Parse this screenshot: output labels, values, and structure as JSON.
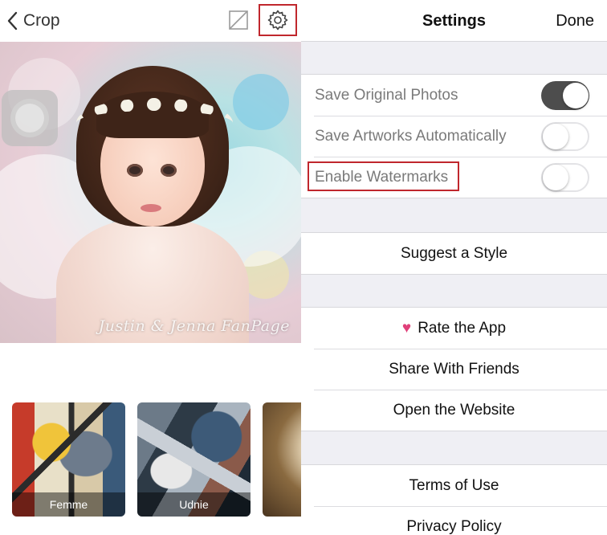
{
  "editor": {
    "back_label": "Crop",
    "watermark": "Justin & Jenna FanPage",
    "styles": [
      {
        "label": "Femme"
      },
      {
        "label": "Udnie"
      },
      {
        "label": ""
      }
    ]
  },
  "settings": {
    "title": "Settings",
    "done_label": "Done",
    "toggles": [
      {
        "label": "Save Original Photos",
        "on": true
      },
      {
        "label": "Save Artworks Automatically",
        "on": false
      },
      {
        "label": "Enable Watermarks",
        "on": false
      }
    ],
    "suggest_label": "Suggest a Style",
    "rate_label": "Rate the App",
    "share_label": "Share With Friends",
    "website_label": "Open the Website",
    "terms_label": "Terms of Use",
    "privacy_label": "Privacy Policy"
  },
  "colors": {
    "highlight": "#c0272d",
    "toggle_on": "#4d4d4d",
    "background_grouped": "#efeff4",
    "heart": "#e0407a"
  },
  "icons": {
    "back": "chevron-left-icon",
    "crop": "crop-square-icon",
    "settings": "gear-icon",
    "rate": "sparkling-heart-icon"
  }
}
